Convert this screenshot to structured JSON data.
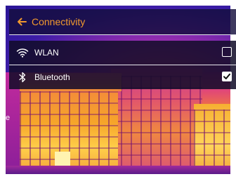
{
  "header": {
    "title": "Connectivity",
    "back_icon": "back-arrow-icon",
    "title_color": "#f29a2e"
  },
  "settings": [
    {
      "label": "WLAN",
      "icon": "wifi-icon",
      "checked": false
    },
    {
      "label": "Bluetooth",
      "icon": "bluetooth-icon",
      "checked": true
    }
  ],
  "background": {
    "type": "thermal-image",
    "edge_text": "e"
  }
}
